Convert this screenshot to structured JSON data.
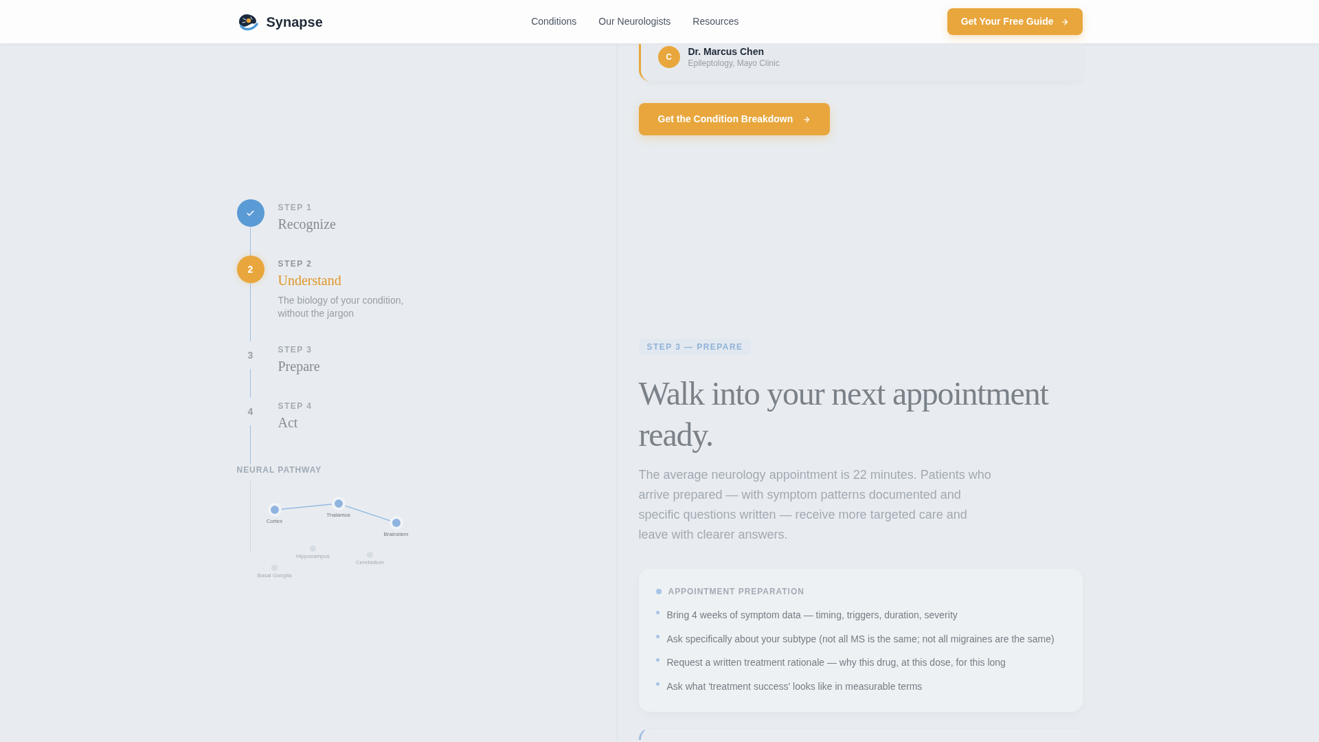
{
  "header": {
    "brand": "Synapse",
    "nav": [
      "Conditions",
      "Our Neurologists",
      "Resources"
    ],
    "cta": "Get Your Free Guide"
  },
  "steps": [
    {
      "label": "STEP 1",
      "title": "Recognize",
      "completed": true,
      "selected": false
    },
    {
      "number": "2",
      "label": "STEP 2",
      "title": "Understand",
      "completed": false,
      "selected": true,
      "description": "The biology of your condition, without the jargon"
    },
    {
      "number": "3",
      "label": "STEP 3",
      "title": "Prepare",
      "completed": false,
      "selected": false
    },
    {
      "number": "4",
      "label": "STEP 4",
      "title": "Act",
      "completed": false,
      "selected": false
    }
  ],
  "neural_pathway": {
    "title": "NEURAL PATHWAY",
    "nodes": [
      {
        "label": "Cortex",
        "active": true
      },
      {
        "label": "Thalamus",
        "active": true
      },
      {
        "label": "Brainstem",
        "active": true
      },
      {
        "label": "Hippocampus",
        "active": false
      },
      {
        "label": "Cerebellum",
        "active": false
      },
      {
        "label": "Basal Ganglia",
        "active": false
      }
    ]
  },
  "expert_card": {
    "avatar": "C",
    "name": "Dr. Marcus Chen",
    "affiliation": "Epileptology, Mayo Clinic"
  },
  "breakdown_button": "Get the Condition Breakdown",
  "section": {
    "tag": "STEP 3 — PREPARE",
    "heading": "Walk into your next appointment ready.",
    "body": "The average neurology appointment is 22 minutes. Patients who arrive prepared — with symptom patterns documented and specific questions written — receive more targeted care and leave with clearer answers.",
    "checklist": {
      "title": "APPOINTMENT PREPARATION",
      "items": [
        "Bring 4 weeks of symptom data — timing, triggers, duration, severity",
        "Ask specifically about your subtype (not all MS is the same; not all migraines are the same)",
        "Request a written treatment rationale — why this drug, at this dose, for this long",
        "Ask what 'treatment success' looks like in measurable terms"
      ]
    }
  }
}
